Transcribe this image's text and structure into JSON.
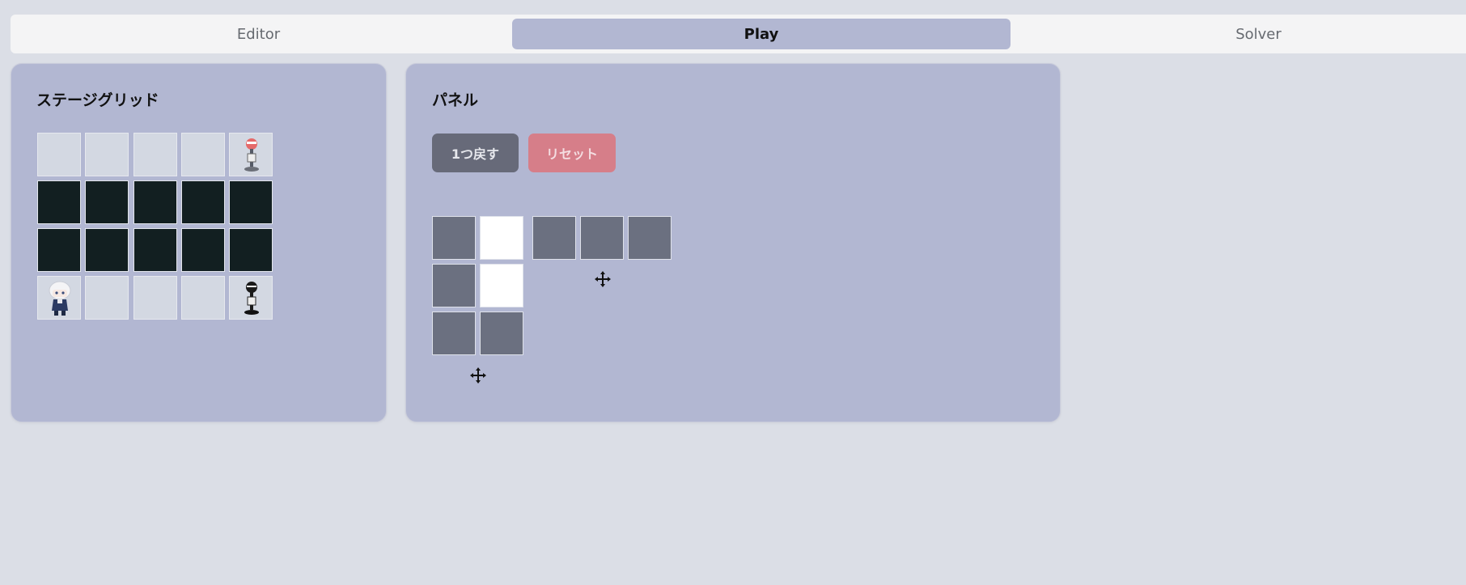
{
  "tabs": [
    {
      "label": "Editor",
      "active": false
    },
    {
      "label": "Play",
      "active": true
    },
    {
      "label": "Solver",
      "active": false
    }
  ],
  "stage": {
    "title": "ステージグリッド",
    "grid": [
      [
        "empty",
        "empty",
        "empty",
        "empty",
        "goal-red"
      ],
      [
        "wall",
        "wall",
        "wall",
        "wall",
        "wall"
      ],
      [
        "wall",
        "wall",
        "wall",
        "wall",
        "wall"
      ],
      [
        "player",
        "empty",
        "empty",
        "empty",
        "goal-black"
      ]
    ]
  },
  "panel": {
    "title": "パネル",
    "undo_label": "1つ戻す",
    "reset_label": "リセット",
    "pieces": [
      {
        "name": "piece-l-shape",
        "cells": [
          [
            "gray",
            "white"
          ],
          [
            "gray",
            "white"
          ],
          [
            "gray",
            "gray"
          ]
        ]
      },
      {
        "name": "piece-i-shape",
        "cells": [
          [
            "gray",
            "gray",
            "gray"
          ]
        ]
      }
    ]
  },
  "icons": {
    "move": "move-arrows-icon",
    "player": "white-haired-character-icon",
    "goal_red": "red-signpost-icon",
    "goal_black": "black-signpost-icon"
  },
  "colors": {
    "background": "#dbdee6",
    "card": "#b2b7d2",
    "wall": "#121f21",
    "empty": "#d3d8e2",
    "panel_gray": "#6b7080",
    "reset": "#d67e89",
    "undo": "#676a79"
  }
}
